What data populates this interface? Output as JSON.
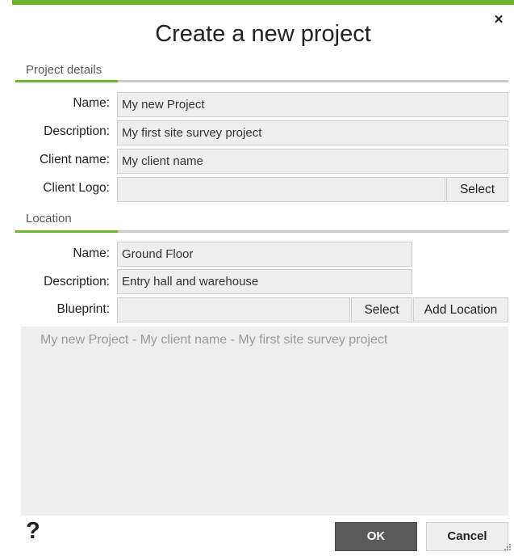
{
  "dialog": {
    "title": "Create a new project",
    "close_label": "×",
    "accent_color": "#6fb52c"
  },
  "project_details": {
    "section_label": "Project details",
    "name_label": "Name:",
    "name_value": "My new Project",
    "description_label": "Description:",
    "description_value": "My first site survey project",
    "client_name_label": "Client name:",
    "client_name_value": "My client name",
    "client_logo_label": "Client Logo:",
    "client_logo_value": "",
    "select_label": "Select"
  },
  "location": {
    "section_label": "Location",
    "name_label": "Name:",
    "name_value": "Ground Floor",
    "description_label": "Description:",
    "description_value": "Entry hall and warehouse",
    "blueprint_label": "Blueprint:",
    "blueprint_value": "",
    "select_label": "Select",
    "add_location_label": "Add Location"
  },
  "summary": {
    "text": "My new Project - My client name - My first site survey project"
  },
  "footer": {
    "help_label": "?",
    "ok_label": "OK",
    "cancel_label": "Cancel",
    "ok_color": "#5a5a5a"
  }
}
